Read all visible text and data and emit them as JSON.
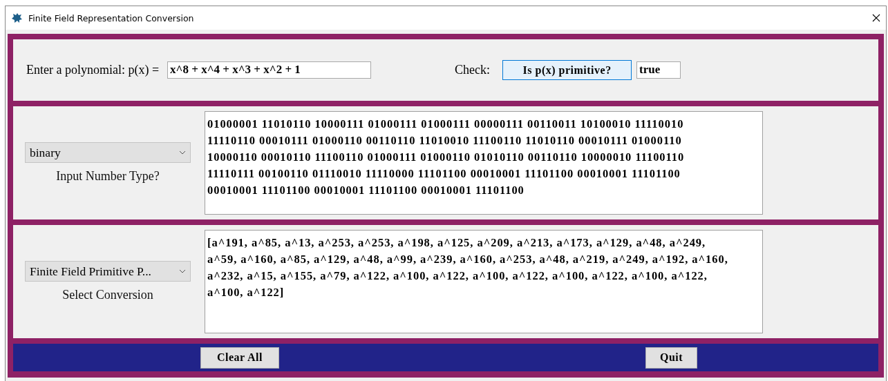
{
  "window": {
    "title": "Finite Field Representation Conversion"
  },
  "polynomial": {
    "label": "Enter a polynomial: p(x) =",
    "value": "x^8 + x^4 + x^3 + x^2 + 1"
  },
  "check": {
    "label": "Check:",
    "button": "Is p(x) primitive?",
    "button_focused": true,
    "result": "true"
  },
  "rows": [
    {
      "dropdown": "binary",
      "caption": "Input Number Type?",
      "lines": [
        "01000001 11010110 10000111 01000111 01000111 00000111 00110011 10100010 11110010",
        "11110110 00010111 01000110 00110110 11010010 11100110 11010110 00010111 01000110",
        "10000110 00010110 11100110 01000111 01000110 01010110 00110110 10000010 11100110",
        "11110111 00100110 01110010 11110000 11101100 00010001 11101100 00010001 11101100",
        "00010001 11101100 00010001 11101100 00010001 11101100"
      ]
    },
    {
      "dropdown": "Finite Field Primitive P...",
      "caption": "Select Conversion",
      "lines": [
        "[a^191, a^85, a^13, a^253, a^253, a^198, a^125, a^209, a^213, a^173, a^129, a^48, a^249,",
        "a^59, a^160, a^85, a^129, a^48, a^99, a^239, a^160, a^253, a^48, a^219, a^249, a^192, a^160,",
        "a^232, a^15, a^155, a^79, a^122, a^100, a^122, a^100, a^122, a^100, a^122, a^100, a^122,",
        "a^100, a^122]"
      ]
    }
  ],
  "buttons": [
    "Clear All",
    "Quit"
  ]
}
